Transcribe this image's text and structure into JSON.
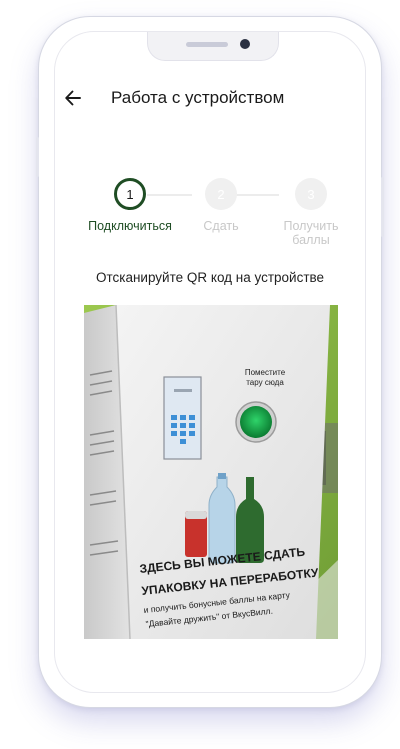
{
  "header": {
    "title": "Работа с устройством"
  },
  "stepper": {
    "steps": [
      {
        "number": "1",
        "label": "Подключиться",
        "state": "active"
      },
      {
        "number": "2",
        "label": "Сдать",
        "state": "inactive"
      },
      {
        "number": "3",
        "label_line1": "Получить",
        "label_line2": "баллы",
        "state": "inactive"
      }
    ]
  },
  "instruction": "Отсканируйте QR код на устройстве",
  "photo": {
    "sign_place": "Поместите",
    "sign_place2": "тару сюда",
    "banner_line1": "ЗДЕСЬ ВЫ МОЖЕТЕ СДАТЬ",
    "banner_line2": "УПАКОВКУ НА ПЕРЕРАБОТКУ",
    "banner_line3": "и получить бонусные баллы на карту",
    "banner_line4": "\"Давайте дружить\" от ВкусВилл."
  },
  "colors": {
    "accent": "#1f4d24",
    "wall": "#8fbe4a"
  }
}
